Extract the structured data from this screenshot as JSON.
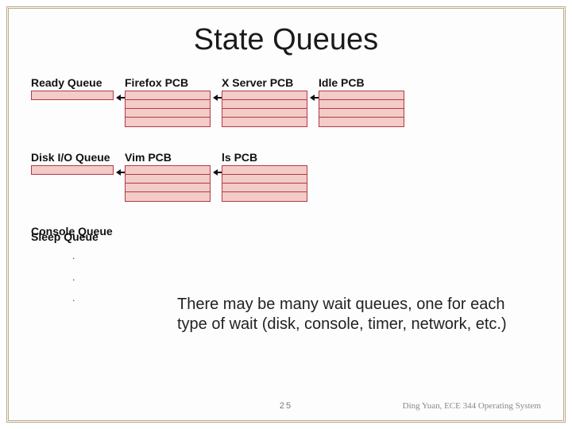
{
  "title": "State Queues",
  "queues": {
    "ready": {
      "head_label": "Ready Queue",
      "pcb1": "Firefox PCB",
      "pcb2": "X Server PCB",
      "pcb3": "Idle PCB"
    },
    "diskio": {
      "head_label": "Disk I/O Queue",
      "pcb1": "Vim PCB",
      "pcb2": "ls PCB"
    },
    "console_label": "Console Queue",
    "sleep_label": "Sleep Queue"
  },
  "note_text": "There may be many wait queues, one for each type of wait (disk, console, timer, network, etc.)",
  "page_number": "25",
  "attribution": "Ding Yuan, ECE 344 Operating System"
}
